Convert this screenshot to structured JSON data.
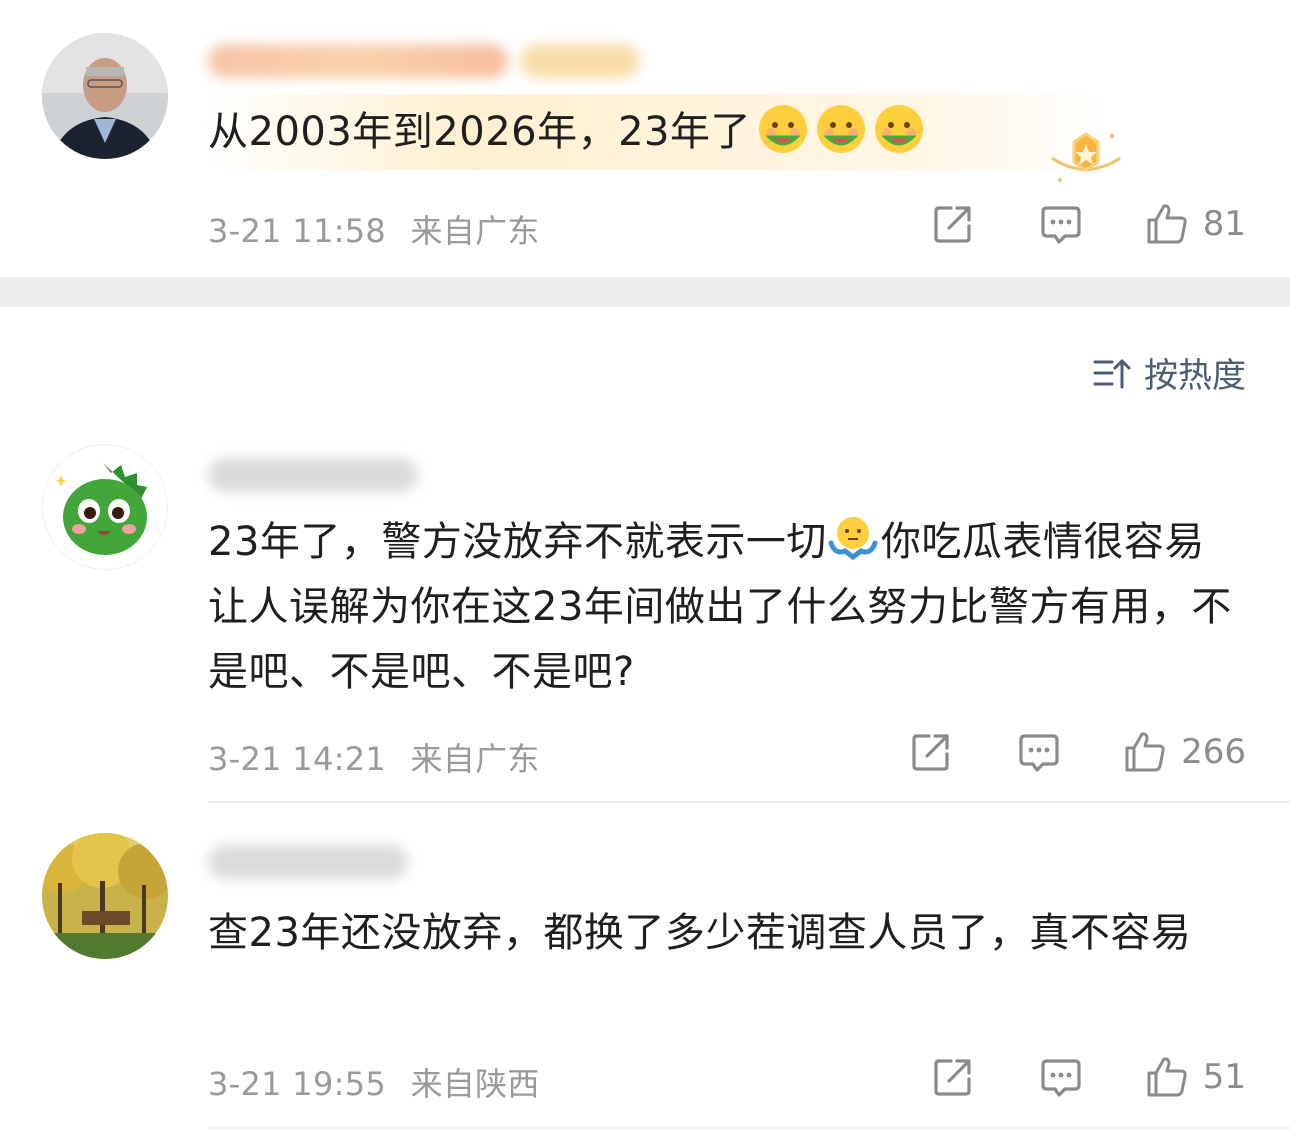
{
  "comments": [
    {
      "text": "从2003年到2026年，23年了",
      "emoji_names": [
        "watermelon-eating-emoji",
        "watermelon-eating-emoji",
        "watermelon-eating-emoji"
      ],
      "time": "3-21 11:58",
      "location": "来自广东",
      "likes": "81",
      "badge_icon": "star-badge-icon"
    },
    {
      "text_before_emoji": "23年了，警方没放弃不就表示一切",
      "emoji_name": "shrug-emoji",
      "text_after_emoji": "你吃瓜表情很容易让人误解为你在这23年间做出了什么努力比警方有用，不是吧、不是吧、不是吧?",
      "time": "3-21 14:21",
      "location": "来自广东",
      "likes": "266"
    },
    {
      "text": "查23年还没放弃，都换了多少茬调查人员了，真不容易",
      "time": "3-21 19:55",
      "location": "来自陕西",
      "likes": "51"
    }
  ],
  "sort": {
    "label": "按热度",
    "icon": "sort-icon"
  },
  "colors": {
    "meta": "#9a9a9a",
    "sort_text": "#4b5c75",
    "separator": "#eeeeee"
  }
}
